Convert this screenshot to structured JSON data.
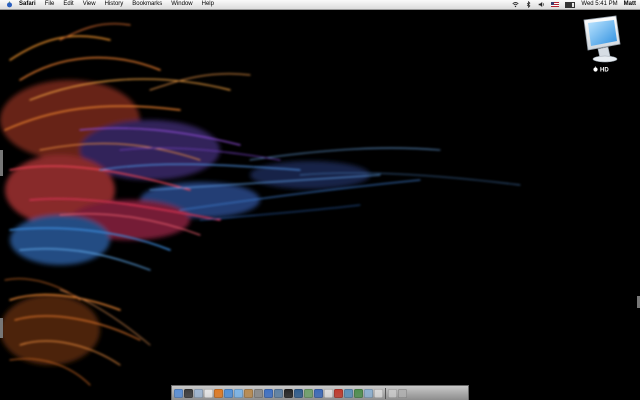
{
  "menubar": {
    "apple_icon": "apple-icon",
    "app_name": "Safari",
    "items": [
      "File",
      "Edit",
      "View",
      "History",
      "Bookmarks",
      "Window",
      "Help"
    ],
    "status": {
      "wifi_icon": "wifi-icon",
      "bluetooth_icon": "bluetooth-icon",
      "volume_icon": "volume-icon",
      "input_flag_icon": "us-flag-icon",
      "battery_icon": "battery-icon",
      "clock": "Wed 5:41 PM",
      "user": "Matt"
    }
  },
  "desktop": {
    "hd_icon": "hard-drive-icon",
    "hd_label": "HD"
  },
  "dock": {
    "icons": [
      {
        "name": "finder-icon",
        "color": "#5a8fd6"
      },
      {
        "name": "dashboard-icon",
        "color": "#3a3a3a"
      },
      {
        "name": "mail-icon",
        "color": "#9fb6d1"
      },
      {
        "name": "ical-icon",
        "color": "#e6e6e6"
      },
      {
        "name": "firefox-icon",
        "color": "#e07a22"
      },
      {
        "name": "safari-icon",
        "color": "#4f8fd8"
      },
      {
        "name": "ichat-icon",
        "color": "#7cb5e8"
      },
      {
        "name": "address-book-icon",
        "color": "#b98a4f"
      },
      {
        "name": "system-preferences-icon",
        "color": "#8a8a8a"
      },
      {
        "name": "itunes-icon",
        "color": "#3d6fc4"
      },
      {
        "name": "iphoto-icon",
        "color": "#5c7fa3"
      },
      {
        "name": "terminal-icon",
        "color": "#222222"
      },
      {
        "name": "photoshop-icon",
        "color": "#2e5b8c"
      },
      {
        "name": "adium-icon",
        "color": "#6fa06a"
      },
      {
        "name": "quicktime-icon",
        "color": "#3a68b8"
      },
      {
        "name": "textedit-icon",
        "color": "#dddddd"
      },
      {
        "name": "acrobat-icon",
        "color": "#c0392b"
      },
      {
        "name": "transmit-icon",
        "color": "#5b8fb9"
      },
      {
        "name": "activity-monitor-icon",
        "color": "#4d8d4d"
      },
      {
        "name": "preview-icon",
        "color": "#8db0d0"
      },
      {
        "name": "utility-icon",
        "color": "#d8d8d8"
      }
    ],
    "right_icons": [
      {
        "name": "documents-stack-icon",
        "color": "#c9c9c9"
      },
      {
        "name": "trash-icon",
        "color": "#b0b0b0"
      }
    ]
  }
}
